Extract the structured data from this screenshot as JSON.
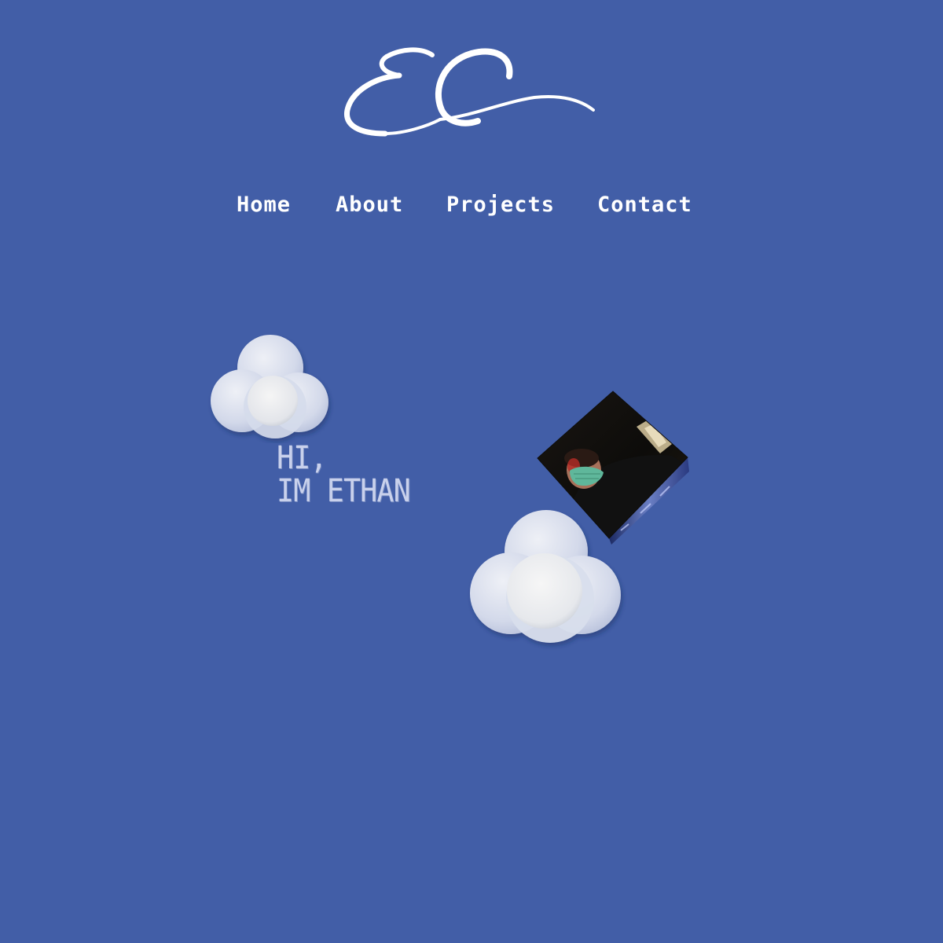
{
  "logo": {
    "text": "EC"
  },
  "nav": {
    "items": [
      {
        "label": "Home"
      },
      {
        "label": "About"
      },
      {
        "label": "Projects"
      },
      {
        "label": "Contact"
      }
    ]
  },
  "hero": {
    "greeting_line1": "HI,",
    "greeting_line2": "IM ETHAN"
  },
  "colors": {
    "background": "#425ea7",
    "text": "#ffffff",
    "greeting": "#c9d1ec",
    "cloud": "#e6e9f3"
  }
}
